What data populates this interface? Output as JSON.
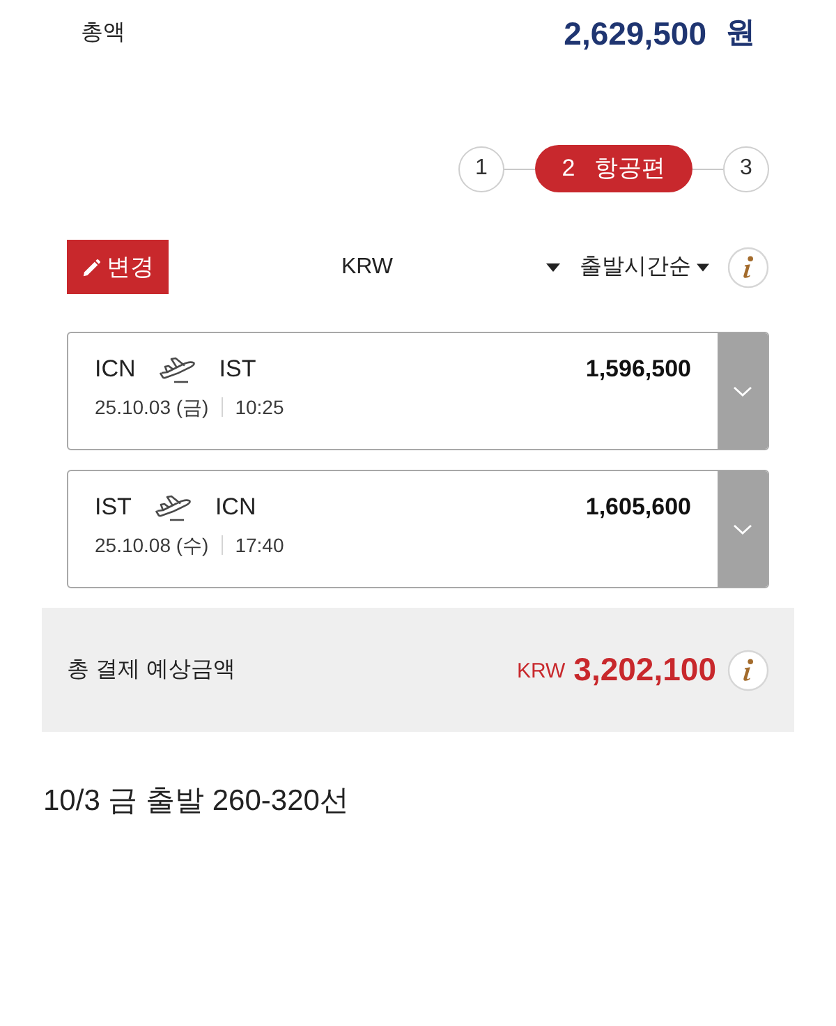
{
  "total": {
    "label": "총액",
    "amount": "2,629,500",
    "unit": "원"
  },
  "steps": [
    {
      "number": "1",
      "selected": false
    },
    {
      "number": "2",
      "title": "항공편",
      "selected": true
    },
    {
      "number": "3",
      "selected": false
    }
  ],
  "toolbar": {
    "edit_button": "변경",
    "currency": "KRW",
    "sort": "출발시간순"
  },
  "flights": [
    {
      "from": "ICN",
      "to": "IST",
      "price": "1,596,500",
      "date": "25.10.03 (금)",
      "time": "10:25"
    },
    {
      "from": "IST",
      "to": "ICN",
      "price": "1,605,600",
      "date": "25.10.08 (수)",
      "time": "17:40"
    }
  ],
  "summary": {
    "label": "총 결제 예상금액",
    "currency": "KRW",
    "amount": "3,202,100"
  },
  "note": "10/3 금 출발 260-320선"
}
